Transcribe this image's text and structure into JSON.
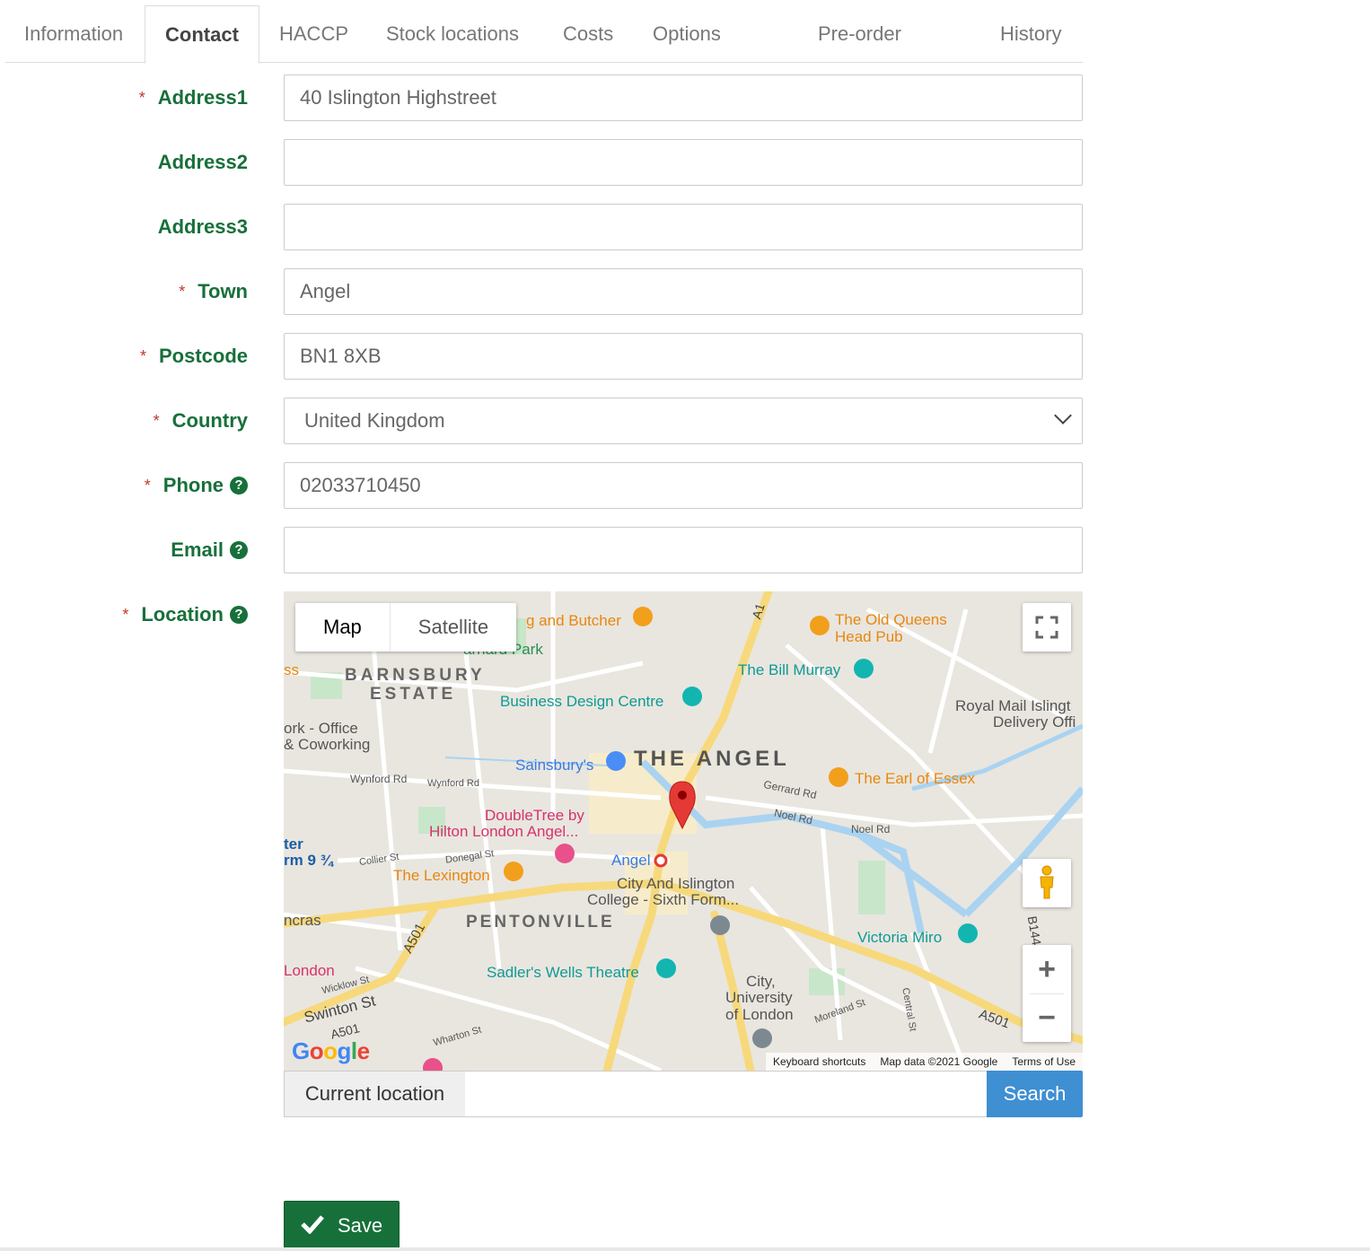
{
  "tabs": [
    {
      "label": "Information"
    },
    {
      "label": "Contact"
    },
    {
      "label": "HACCP"
    },
    {
      "label": "Stock locations"
    },
    {
      "label": "Costs"
    },
    {
      "label": "Options"
    },
    {
      "label": "Pre-order"
    },
    {
      "label": "History"
    }
  ],
  "active_tab": "Contact",
  "form": {
    "address1": {
      "label": "Address1",
      "value": "40 Islington Highstreet",
      "required": true
    },
    "address2": {
      "label": "Address2",
      "value": "",
      "required": false
    },
    "address3": {
      "label": "Address3",
      "value": "",
      "required": false
    },
    "town": {
      "label": "Town",
      "value": "Angel",
      "required": true
    },
    "postcode": {
      "label": "Postcode",
      "value": "BN1 8XB",
      "required": true
    },
    "country": {
      "label": "Country",
      "value": "United Kingdom",
      "required": true
    },
    "phone": {
      "label": "Phone",
      "value": "02033710450",
      "required": true
    },
    "email": {
      "label": "Email",
      "value": "",
      "required": false
    },
    "location": {
      "label": "Location",
      "required": true
    }
  },
  "required_mark": "*",
  "help_glyph": "?",
  "map": {
    "type_map": "Map",
    "type_satellite": "Satellite",
    "zoom_in": "+",
    "zoom_out": "−",
    "footer": {
      "shortcuts": "Keyboard shortcuts",
      "data": "Map data ©2021 Google",
      "terms": "Terms of Use"
    },
    "logo": "Google",
    "labels": {
      "the_angel": "THE ANGEL",
      "barnsbury": "BARNSBURY",
      "estate": "ESTATE",
      "pentonville": "PENTONVILLE",
      "old_queens": "The Old Queens",
      "head_pub": "Head Pub",
      "bill_murray": "The Bill Murray",
      "business_design": "Business Design Centre",
      "sainsburys": "Sainsbury's",
      "earl_essex": "The Earl of Essex",
      "doubletree1": "DoubleTree by",
      "doubletree2": "Hilton London Angel...",
      "lexington": "The Lexington",
      "angel": "Angel",
      "city_islington1": "City And Islington",
      "city_islington2": "College - Sixth Form...",
      "victoria_miro": "Victoria Miro",
      "sadlers": "Sadler's Wells Theatre",
      "city_univ1": "City,",
      "city_univ2": "University",
      "city_univ3": "of London",
      "royal_mail1": "Royal Mail Islingt",
      "royal_mail2": "Delivery Offi",
      "butcher": "g and Butcher",
      "park": "arnard Park",
      "office1": "ork - Office",
      "office2": "& Coworking",
      "london": "London",
      "ncras": "ncras",
      "ter": "ter",
      "rm": "rm 9 ¾",
      "swinton": "Swinton St",
      "a501": "A501",
      "a1": "A1",
      "wynford": "Wynford Rd",
      "noel": "Noel Rd",
      "gerrard": "Gerrard Rd",
      "donegal": "Donegal St",
      "wharton": "Wharton St",
      "moreland": "Moreland St",
      "central": "Central St",
      "wicklow": "Wicklow St",
      "collier": "Collier St",
      "b144": "B144",
      "ss": "ss",
      "st": "St"
    }
  },
  "current_location_label": "Current location",
  "search_input_value": "",
  "search_label": "Search",
  "save_label": "Save",
  "colors": {
    "label_green": "#17703a",
    "required_red": "#c0392b",
    "search_blue": "#3f8fd3",
    "save_green": "#17703a"
  }
}
